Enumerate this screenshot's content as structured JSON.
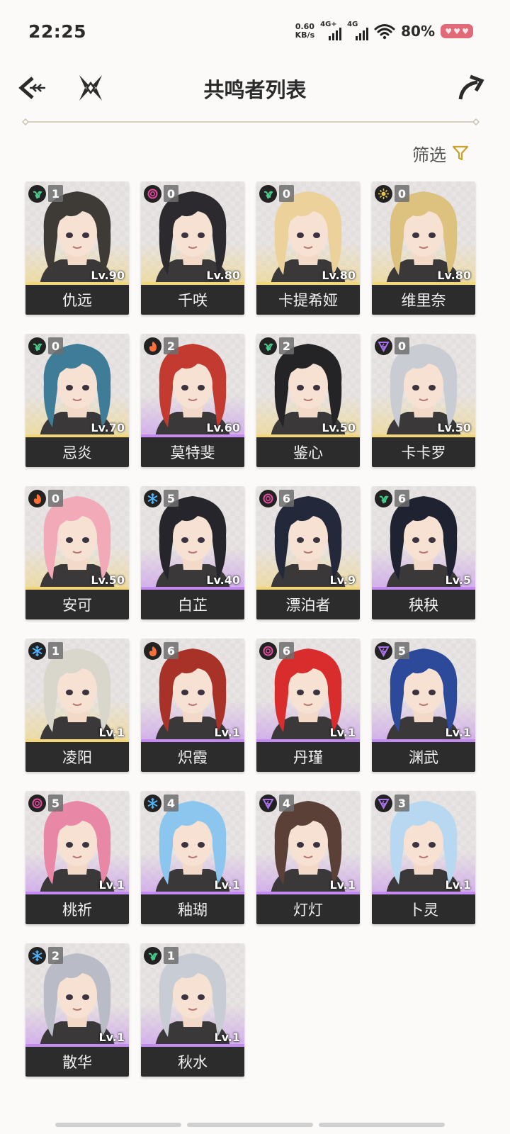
{
  "status_bar": {
    "time": "22:25",
    "net_speed_value": "0.60",
    "net_speed_unit": "KB/s",
    "signal1_label": "4G+",
    "signal2_label": "4G",
    "battery": "80%"
  },
  "header": {
    "title": "共鸣者列表"
  },
  "filter": {
    "label": "筛选"
  },
  "element_colors": {
    "aero": "#46c98a",
    "fusion": "#ff6f3a",
    "havoc": "#e24b9e",
    "spectro": "#e8c84a",
    "glacio": "#52b6ff",
    "electro": "#a972ea"
  },
  "rarity_colors": {
    "5": "#f2d77a",
    "4": "#c48cf0"
  },
  "characters": [
    {
      "name": "仇远",
      "level": "Lv.90",
      "sequence": "1",
      "element": "aero",
      "rarity": 5,
      "hair": "#3e3a36"
    },
    {
      "name": "千咲",
      "level": "Lv.80",
      "sequence": "0",
      "element": "havoc",
      "rarity": 5,
      "hair": "#2c2a2e"
    },
    {
      "name": "卡提希娅",
      "level": "Lv.80",
      "sequence": "0",
      "element": "aero",
      "rarity": 5,
      "hair": "#ecd29a"
    },
    {
      "name": "维里奈",
      "level": "Lv.80",
      "sequence": "0",
      "element": "spectro",
      "rarity": 5,
      "hair": "#dcc27e"
    },
    {
      "name": "忌炎",
      "level": "Lv.70",
      "sequence": "0",
      "element": "aero",
      "rarity": 5,
      "hair": "#3f7c98"
    },
    {
      "name": "莫特斐",
      "level": "Lv.60",
      "sequence": "2",
      "element": "fusion",
      "rarity": 4,
      "hair": "#c23a30"
    },
    {
      "name": "鉴心",
      "level": "Lv.50",
      "sequence": "2",
      "element": "aero",
      "rarity": 5,
      "hair": "#242326"
    },
    {
      "name": "卡卡罗",
      "level": "Lv.50",
      "sequence": "0",
      "element": "electro",
      "rarity": 5,
      "hair": "#c9ccd2"
    },
    {
      "name": "安可",
      "level": "Lv.50",
      "sequence": "0",
      "element": "fusion",
      "rarity": 5,
      "hair": "#f2a9b8"
    },
    {
      "name": "白芷",
      "level": "Lv.40",
      "sequence": "5",
      "element": "glacio",
      "rarity": 4,
      "hair": "#26252b"
    },
    {
      "name": "漂泊者",
      "level": "Lv.9",
      "sequence": "6",
      "element": "havoc",
      "rarity": 5,
      "hair": "#23283a"
    },
    {
      "name": "秧秧",
      "level": "Lv.5",
      "sequence": "6",
      "element": "aero",
      "rarity": 4,
      "hair": "#1f2230"
    },
    {
      "name": "凌阳",
      "level": "Lv.1",
      "sequence": "1",
      "element": "glacio",
      "rarity": 5,
      "hair": "#d9d6cc"
    },
    {
      "name": "炽霞",
      "level": "Lv.1",
      "sequence": "6",
      "element": "fusion",
      "rarity": 4,
      "hair": "#a83228"
    },
    {
      "name": "丹瑾",
      "level": "Lv.1",
      "sequence": "6",
      "element": "havoc",
      "rarity": 4,
      "hair": "#d92d2d"
    },
    {
      "name": "渊武",
      "level": "Lv.1",
      "sequence": "5",
      "element": "electro",
      "rarity": 4,
      "hair": "#2d4a9a"
    },
    {
      "name": "桃祈",
      "level": "Lv.1",
      "sequence": "5",
      "element": "havoc",
      "rarity": 4,
      "hair": "#e887a6"
    },
    {
      "name": "釉瑚",
      "level": "Lv.1",
      "sequence": "4",
      "element": "glacio",
      "rarity": 4,
      "hair": "#8cc6ee"
    },
    {
      "name": "灯灯",
      "level": "Lv.1",
      "sequence": "4",
      "element": "electro",
      "rarity": 4,
      "hair": "#5b4038"
    },
    {
      "name": "卜灵",
      "level": "Lv.1",
      "sequence": "3",
      "element": "electro",
      "rarity": 4,
      "hair": "#b7d8f0"
    },
    {
      "name": "散华",
      "level": "Lv.1",
      "sequence": "2",
      "element": "glacio",
      "rarity": 4,
      "hair": "#b9bcc6"
    },
    {
      "name": "秋水",
      "level": "Lv.1",
      "sequence": "1",
      "element": "aero",
      "rarity": 4,
      "hair": "#c8ccd4"
    }
  ]
}
